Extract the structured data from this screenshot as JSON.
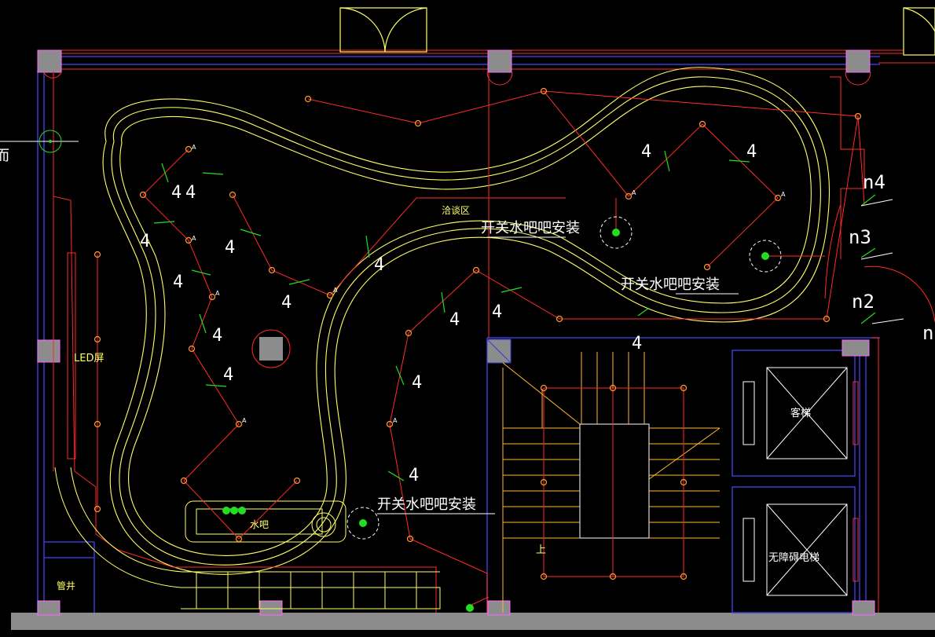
{
  "plan": {
    "labels": {
      "negotiation_area": "洽谈区",
      "led_screen": "LED屏",
      "water_bar": "水吧",
      "pipe_shaft": "管井",
      "passenger_elevator": "客梯",
      "accessible_elevator": "无障碍电梯",
      "stair_up": "上",
      "left_edge_fragment": "而"
    },
    "callouts": {
      "switch_top": "开关水吧吧安装",
      "switch_right": "开关水吧吧安装",
      "switch_bottom": "开关水吧吧安装"
    },
    "circuits": {
      "n2": "n2",
      "n3": "n3",
      "n4": "n4",
      "edge_n": "n"
    },
    "wire_counts": [
      "4",
      "4",
      "4",
      "4",
      "4",
      "4",
      "4",
      "4",
      "4",
      "4",
      "4",
      "4",
      "4",
      "4",
      "4",
      "4"
    ],
    "fixture_tag": "A",
    "colors": {
      "background": "#000000",
      "wall_outline": "#3b3bd6",
      "wiring": "#ff2a2a",
      "ceiling_curve": "#ffff66",
      "column_fill": "#8c8c8c",
      "green_mark": "#22dd22",
      "text": "#ffffff"
    }
  }
}
